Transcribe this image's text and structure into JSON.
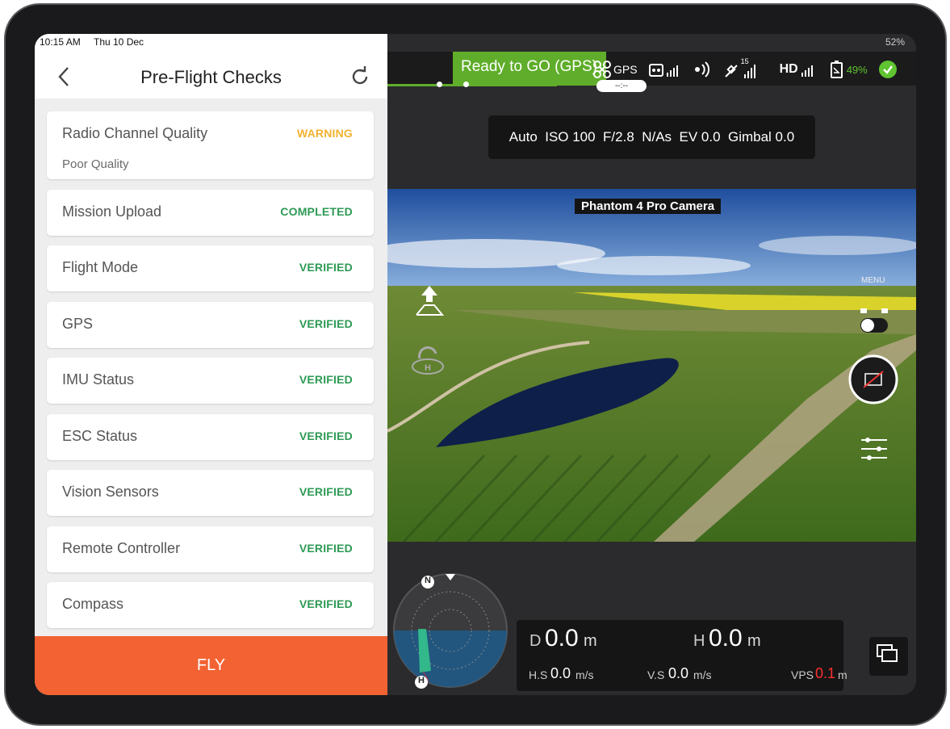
{
  "status_bar": {
    "time": "10:15 AM",
    "date": "Thu 10 Dec",
    "battery": "52%"
  },
  "header": {
    "title": "Pre-Flight Checks"
  },
  "checks": [
    {
      "name": "Radio Channel Quality",
      "status": "WARNING",
      "detail": "Poor Quality"
    },
    {
      "name": "Mission Upload",
      "status": "COMPLETED"
    },
    {
      "name": "Flight Mode",
      "status": "VERIFIED"
    },
    {
      "name": "GPS",
      "status": "VERIFIED"
    },
    {
      "name": "IMU Status",
      "status": "VERIFIED"
    },
    {
      "name": "ESC Status",
      "status": "VERIFIED"
    },
    {
      "name": "Vision Sensors",
      "status": "VERIFIED"
    },
    {
      "name": "Remote Controller",
      "status": "VERIFIED"
    },
    {
      "name": "Compass",
      "status": "VERIFIED"
    }
  ],
  "fly_button": {
    "label": "FLY"
  },
  "dji": {
    "status": "Ready to GO (GPS)",
    "timer": "--:--",
    "gps_label": "GPS",
    "satellites": "15",
    "hd_label": "HD",
    "battery": "49%",
    "camera_settings": "Auto  ISO 100  F/2.8  N/As  EV 0.0  Gimbal 0.0",
    "camera_name": "Phantom 4 Pro Camera",
    "menu_label": "MENU",
    "telemetry": {
      "d_label": "D",
      "d_value": "0.0",
      "d_unit": "m",
      "h_label": "H",
      "h_value": "0.0",
      "h_unit": "m",
      "hs_label": "H.S",
      "hs_value": "0.0",
      "hs_unit": "m/s",
      "vs_label": "V.S",
      "vs_value": "0.0",
      "vs_unit": "m/s",
      "vps_label": "VPS",
      "vps_value": "0.1",
      "vps_unit": "m"
    },
    "radar": {
      "north": "N",
      "home": "H"
    }
  },
  "colors": {
    "accent": "#f26232",
    "ok": "#2e9a55",
    "warning": "#f1b22f",
    "ready": "#5fad2a"
  }
}
